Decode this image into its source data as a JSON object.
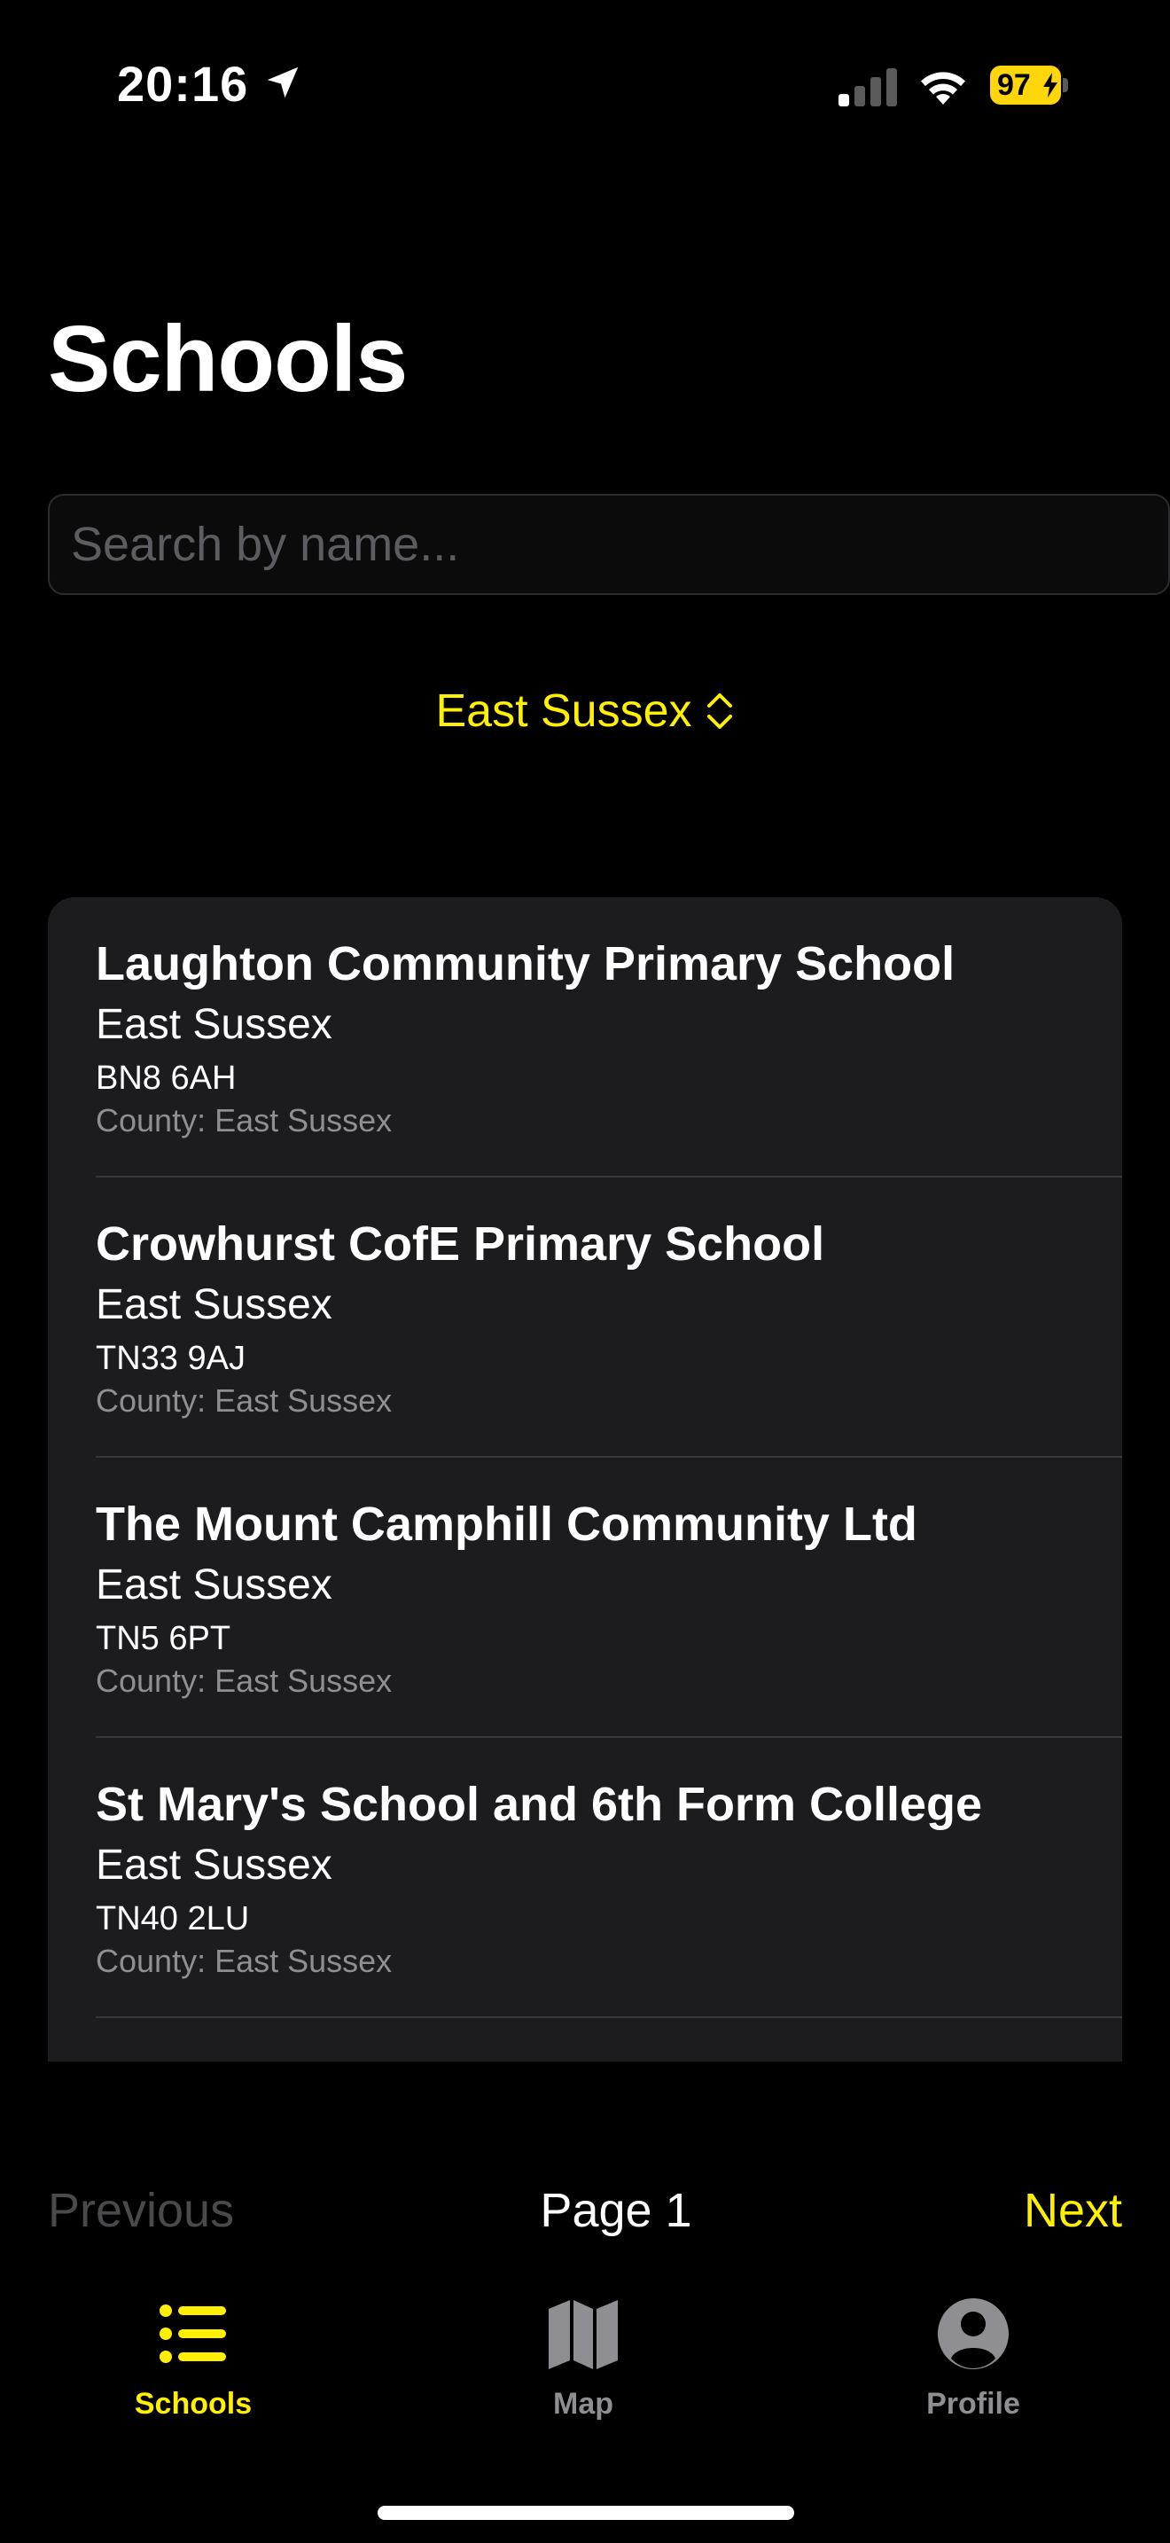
{
  "status_bar": {
    "time": "20:16",
    "battery": "97"
  },
  "header": {
    "title": "Schools"
  },
  "search": {
    "placeholder": "Search by name...",
    "value": ""
  },
  "county_picker": {
    "selected": "East Sussex"
  },
  "schools": [
    {
      "name": "Laughton Community Primary School",
      "area": "East Sussex",
      "postcode": "BN8 6AH",
      "county": "County: East Sussex"
    },
    {
      "name": "Crowhurst CofE Primary School",
      "area": "East Sussex",
      "postcode": "TN33 9AJ",
      "county": "County: East Sussex"
    },
    {
      "name": "The Mount Camphill Community Ltd",
      "area": "East Sussex",
      "postcode": "TN5 6PT",
      "county": "County: East Sussex"
    },
    {
      "name": "St Mary's School and 6th Form College",
      "area": "East Sussex",
      "postcode": "TN40 2LU",
      "county": "County: East Sussex"
    }
  ],
  "pagination": {
    "previous_label": "Previous",
    "page_label": "Page 1",
    "next_label": "Next"
  },
  "tab_bar": {
    "tabs": [
      {
        "label": "Schools",
        "icon": "list-icon",
        "active": true
      },
      {
        "label": "Map",
        "icon": "map-icon",
        "active": false
      },
      {
        "label": "Profile",
        "icon": "person-circle-icon",
        "active": false
      }
    ]
  },
  "colors": {
    "accent": "#ffef00",
    "background": "#000000",
    "card": "#1c1c1e",
    "secondary_text": "#8e8e93"
  }
}
